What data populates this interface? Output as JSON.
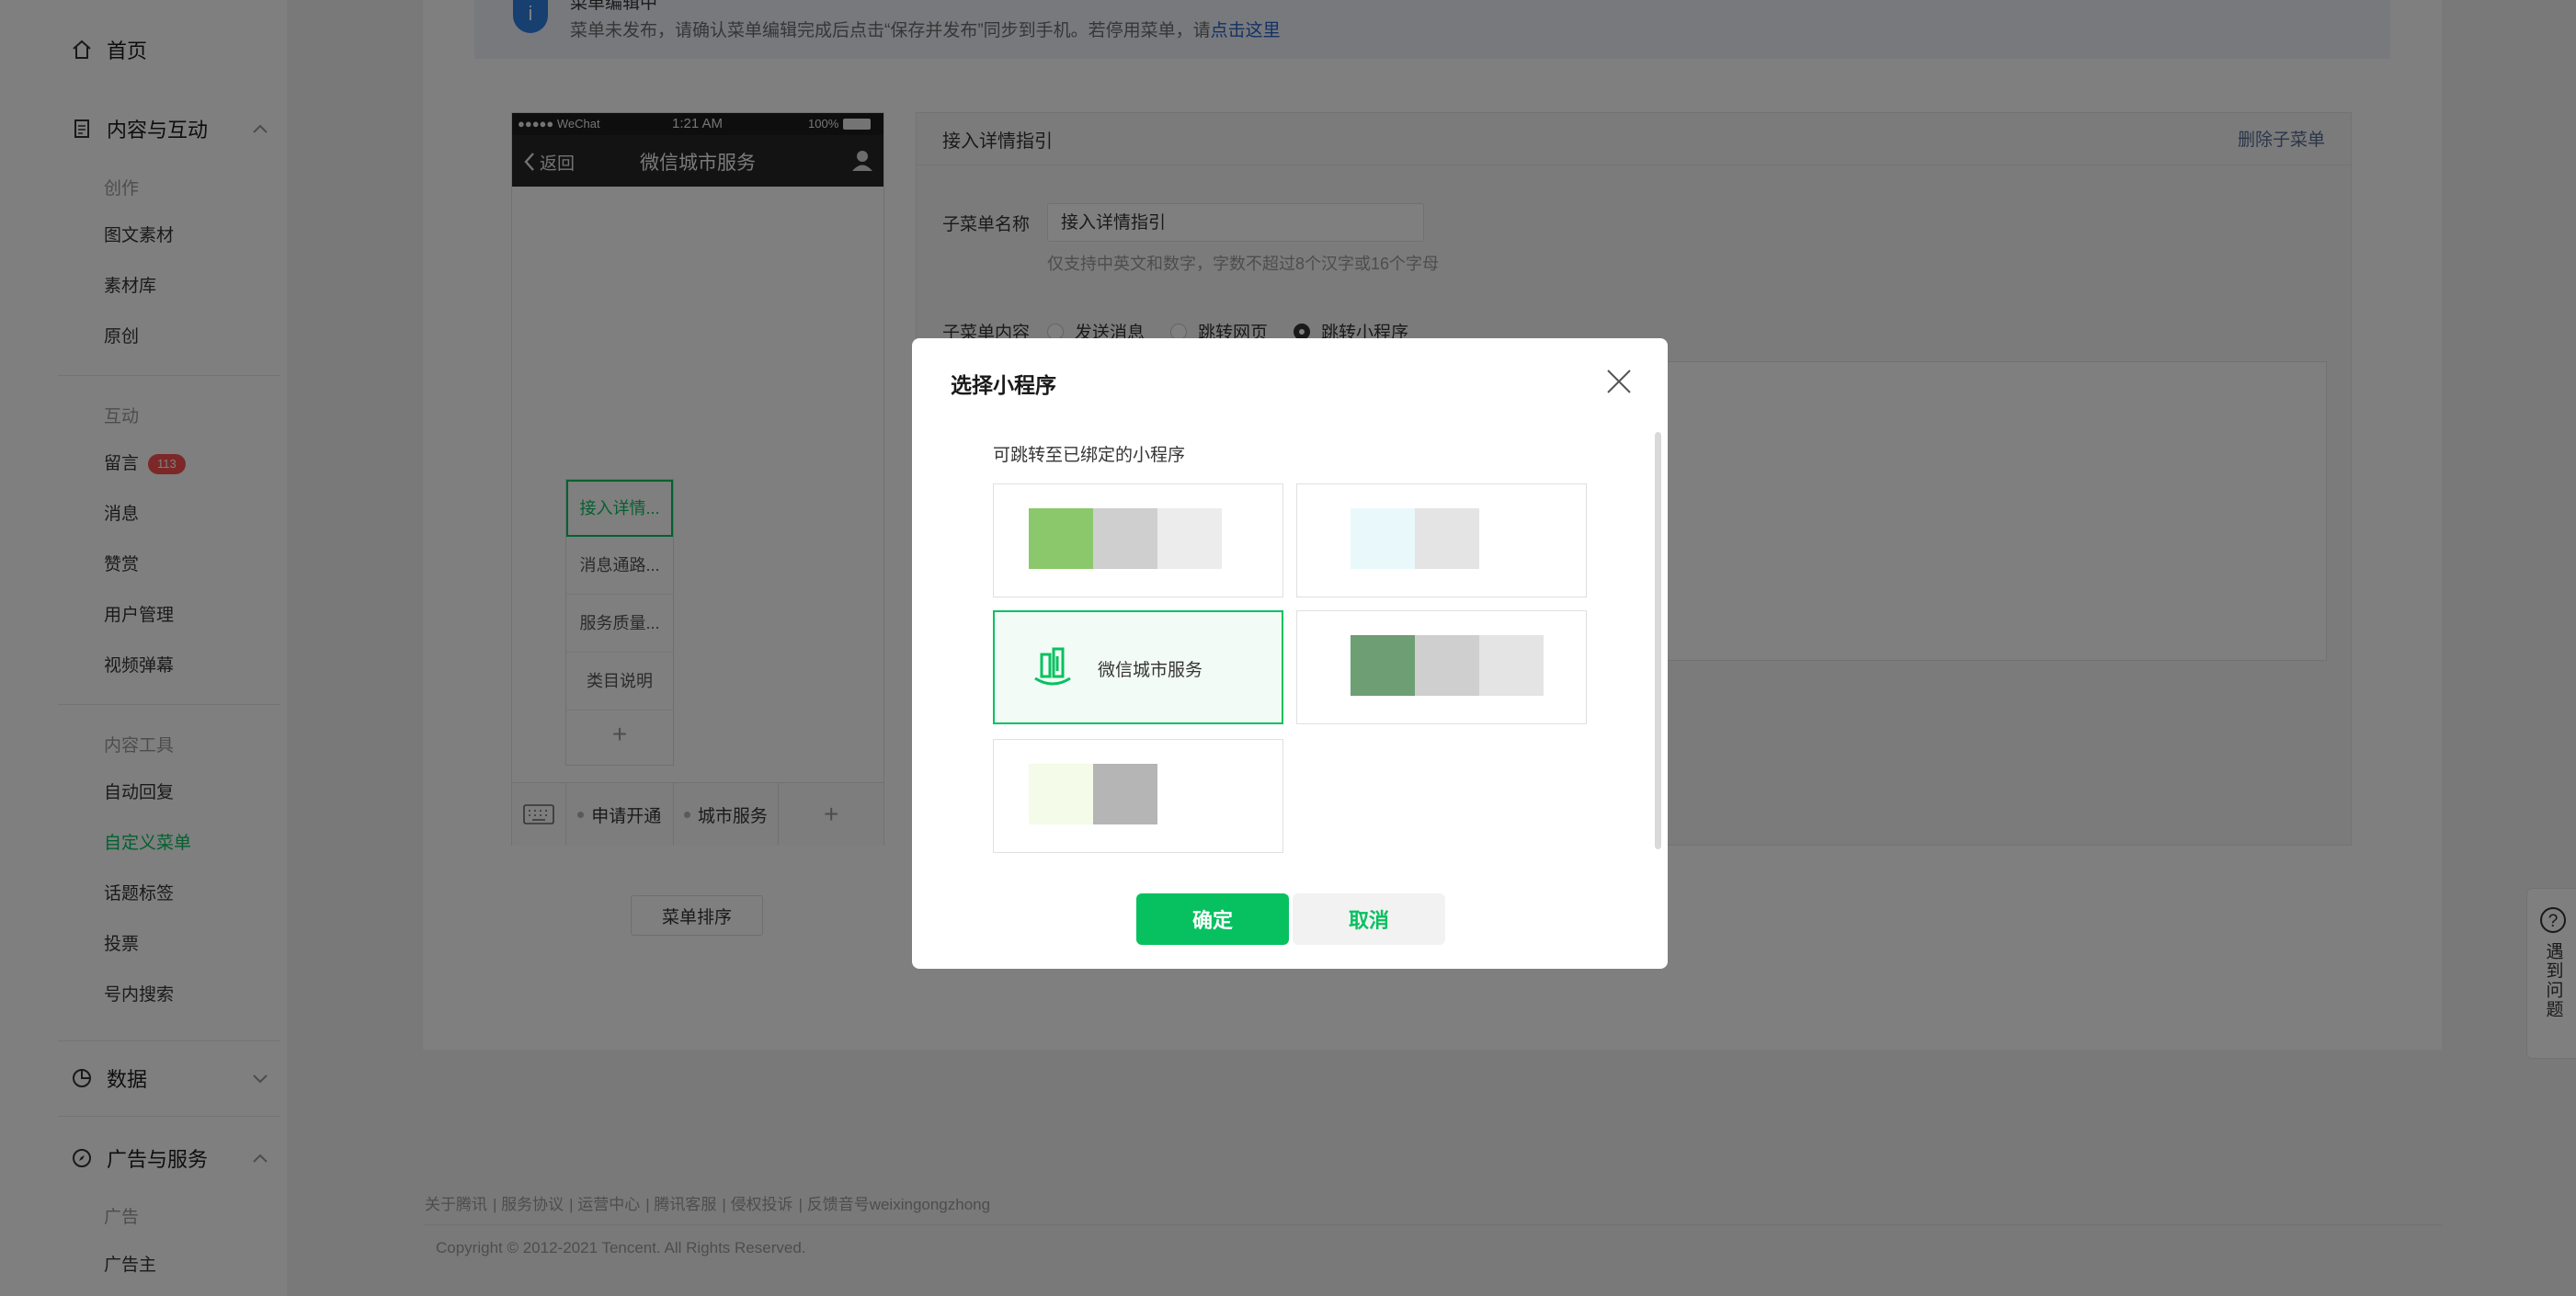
{
  "sidebar": {
    "home": "首页",
    "content": "内容与互动",
    "groups": {
      "create": "创作",
      "interact": "互动",
      "tools": "内容工具",
      "ads": "广告"
    },
    "create_items": [
      "图文素材",
      "素材库",
      "原创"
    ],
    "interact_items": [
      "留言",
      "消息",
      "赞赏",
      "用户管理",
      "视频弹幕"
    ],
    "comment_badge": "113",
    "tool_items": [
      "自动回复",
      "自定义菜单",
      "话题标签",
      "投票",
      "号内搜索"
    ],
    "data": "数据",
    "ads_services": "广告与服务",
    "ad_items": [
      "广告主"
    ]
  },
  "notice": {
    "title": "菜单编辑中",
    "text": "菜单未发布，请确认菜单编辑完成后点击“保存并发布”同步到手机。若停用菜单，请",
    "link": "点击这里"
  },
  "phone": {
    "carrier": "●●●●● WeChat",
    "time": "1:21 AM",
    "battery": "100%",
    "back": "返回",
    "title": "微信城市服务",
    "submenu": [
      "接入详情...",
      "消息通路...",
      "服务质量...",
      "类目说明"
    ],
    "add": "+",
    "bar": [
      "申请开通",
      "城市服务"
    ]
  },
  "sort_button": "菜单排序",
  "editor": {
    "name": "接入详情指引",
    "delete": "删除子菜单",
    "name_label": "子菜单名称",
    "name_value": "接入详情指引",
    "hint": "仅支持中英文和数字，字数不超过8个汉字或16个字母",
    "content_label": "子菜单内容",
    "options": [
      "发送消息",
      "跳转网页",
      "跳转小程序"
    ],
    "selected_option": 2
  },
  "footer": {
    "links": [
      "关于腾讯",
      "服务协议",
      "运营中心",
      "腾讯客服",
      "侵权投诉",
      "反馈音号weixingongzhong"
    ],
    "copyright": "Copyright © 2012-2021 Tencent. All Rights Reserved."
  },
  "help": "遇到问题",
  "modal": {
    "title": "选择小程序",
    "subtitle": "可跳转至已绑定的小程序",
    "selected_name": "微信城市服务",
    "confirm": "确定",
    "cancel": "取消",
    "accent": "#07c160"
  }
}
